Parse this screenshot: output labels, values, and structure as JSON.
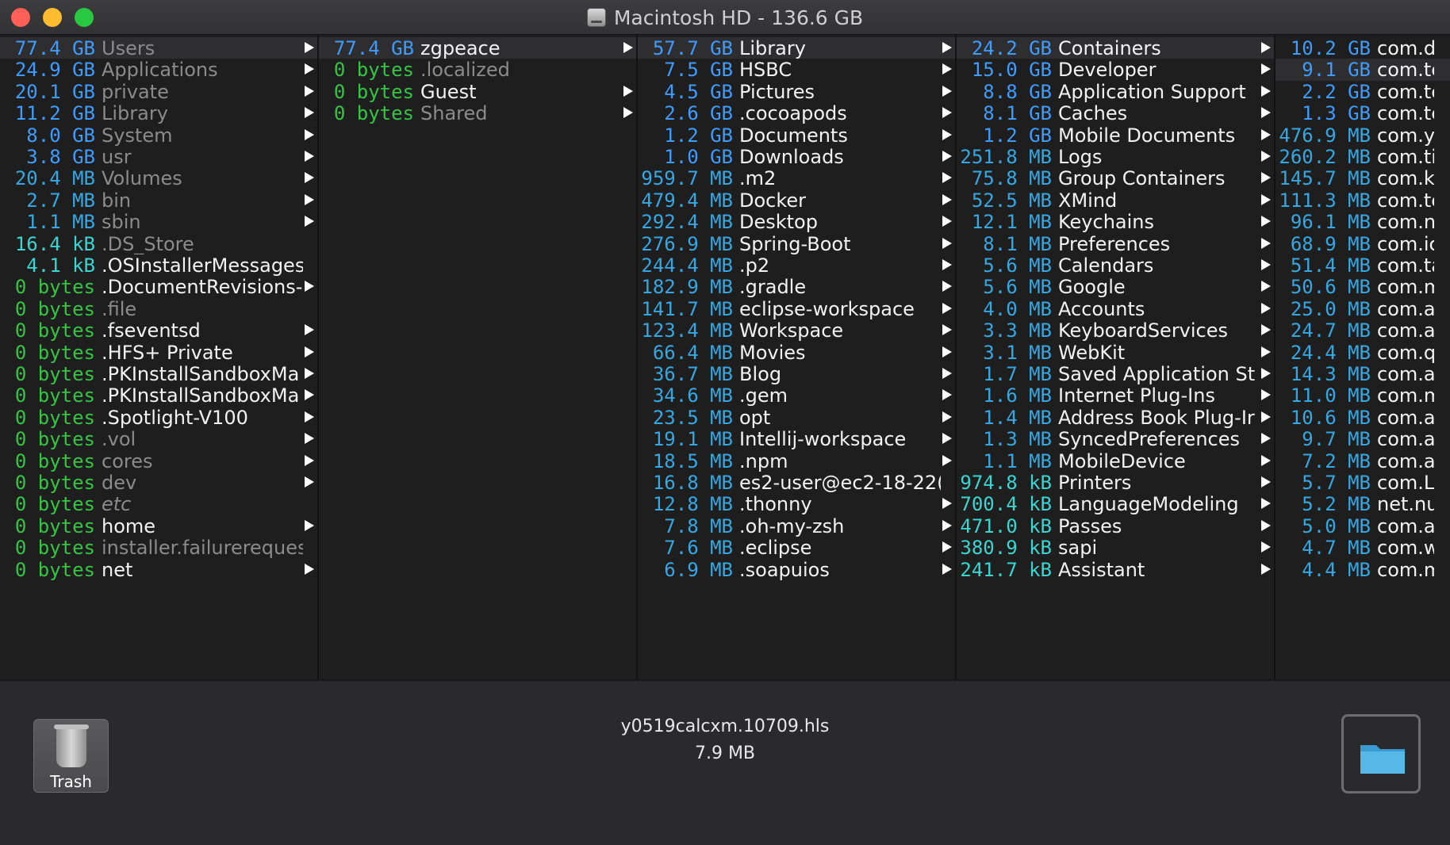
{
  "window": {
    "title": "Macintosh HD - 136.6 GB",
    "traffic_colors": {
      "close": "#fe5f57",
      "minimize": "#febc2e",
      "maximize": "#28c840"
    }
  },
  "colors": {
    "gb": "#3f9cff",
    "mb": "#35a8e4",
    "kb": "#39d6d2",
    "bytes": "#35c444",
    "name": "#f2f2f2",
    "name_dim": "#8b8b8b",
    "selected_row": "#2e2e31"
  },
  "columns": [
    {
      "id": "root",
      "items": [
        {
          "size": "77.4 GB",
          "unit": "gb",
          "name": "Users",
          "arrow": true,
          "dim": true,
          "selected": true
        },
        {
          "size": "24.9 GB",
          "unit": "gb",
          "name": "Applications",
          "arrow": true,
          "dim": true
        },
        {
          "size": "20.1 GB",
          "unit": "gb",
          "name": "private",
          "arrow": true,
          "dim": true
        },
        {
          "size": "11.2 GB",
          "unit": "gb",
          "name": "Library",
          "arrow": true,
          "dim": true
        },
        {
          "size": "8.0 GB",
          "unit": "gb",
          "name": "System",
          "arrow": true,
          "dim": true
        },
        {
          "size": "3.8 GB",
          "unit": "gb",
          "name": "usr",
          "arrow": true,
          "dim": true
        },
        {
          "size": "20.4 MB",
          "unit": "mb",
          "name": "Volumes",
          "arrow": true,
          "dim": true
        },
        {
          "size": "2.7 MB",
          "unit": "mb",
          "name": "bin",
          "arrow": true,
          "dim": true
        },
        {
          "size": "1.1 MB",
          "unit": "mb",
          "name": "sbin",
          "arrow": true,
          "dim": true
        },
        {
          "size": "16.4 kB",
          "unit": "kb",
          "name": ".DS_Store",
          "arrow": false,
          "dim": true
        },
        {
          "size": "4.1 kB",
          "unit": "kb",
          "name": ".OSInstallerMessages",
          "arrow": false
        },
        {
          "size": "0 bytes",
          "unit": "bytes",
          "name": ".DocumentRevisions-",
          "arrow": true
        },
        {
          "size": "0 bytes",
          "unit": "bytes",
          "name": ".file",
          "arrow": false,
          "dim": true
        },
        {
          "size": "0 bytes",
          "unit": "bytes",
          "name": ".fseventsd",
          "arrow": true
        },
        {
          "size": "0 bytes",
          "unit": "bytes",
          "name": ".HFS+ Private",
          "arrow": true
        },
        {
          "size": "0 bytes",
          "unit": "bytes",
          "name": ".PKInstallSandboxMa",
          "arrow": true
        },
        {
          "size": "0 bytes",
          "unit": "bytes",
          "name": ".PKInstallSandboxMa",
          "arrow": true
        },
        {
          "size": "0 bytes",
          "unit": "bytes",
          "name": ".Spotlight-V100",
          "arrow": true
        },
        {
          "size": "0 bytes",
          "unit": "bytes",
          "name": ".vol",
          "arrow": true,
          "dim": true
        },
        {
          "size": "0 bytes",
          "unit": "bytes",
          "name": "cores",
          "arrow": true,
          "dim": true
        },
        {
          "size": "0 bytes",
          "unit": "bytes",
          "name": "dev",
          "arrow": true,
          "dim": true
        },
        {
          "size": "0 bytes",
          "unit": "bytes",
          "name": "etc",
          "arrow": false,
          "dim": true,
          "italic": true
        },
        {
          "size": "0 bytes",
          "unit": "bytes",
          "name": "home",
          "arrow": true
        },
        {
          "size": "0 bytes",
          "unit": "bytes",
          "name": "installer.failurerequest",
          "arrow": false,
          "dim": true
        },
        {
          "size": "0 bytes",
          "unit": "bytes",
          "name": "net",
          "arrow": true
        }
      ]
    },
    {
      "id": "users",
      "items": [
        {
          "size": "77.4 GB",
          "unit": "gb",
          "name": "zgpeace",
          "arrow": true,
          "selected": true
        },
        {
          "size": "0 bytes",
          "unit": "bytes",
          "name": ".localized",
          "arrow": false,
          "dim": true
        },
        {
          "size": "0 bytes",
          "unit": "bytes",
          "name": "Guest",
          "arrow": true
        },
        {
          "size": "0 bytes",
          "unit": "bytes",
          "name": "Shared",
          "arrow": true,
          "dim": true
        }
      ]
    },
    {
      "id": "zgpeace",
      "items": [
        {
          "size": "57.7 GB",
          "unit": "gb",
          "name": "Library",
          "arrow": true,
          "selected": true
        },
        {
          "size": "7.5 GB",
          "unit": "gb",
          "name": "HSBC",
          "arrow": true
        },
        {
          "size": "4.5 GB",
          "unit": "gb",
          "name": "Pictures",
          "arrow": true
        },
        {
          "size": "2.6 GB",
          "unit": "gb",
          "name": ".cocoapods",
          "arrow": true
        },
        {
          "size": "1.2 GB",
          "unit": "gb",
          "name": "Documents",
          "arrow": true
        },
        {
          "size": "1.0 GB",
          "unit": "gb",
          "name": "Downloads",
          "arrow": true
        },
        {
          "size": "959.7 MB",
          "unit": "mb",
          "name": ".m2",
          "arrow": true
        },
        {
          "size": "479.4 MB",
          "unit": "mb",
          "name": "Docker",
          "arrow": true
        },
        {
          "size": "292.4 MB",
          "unit": "mb",
          "name": "Desktop",
          "arrow": true
        },
        {
          "size": "276.9 MB",
          "unit": "mb",
          "name": "Spring-Boot",
          "arrow": true
        },
        {
          "size": "244.4 MB",
          "unit": "mb",
          "name": ".p2",
          "arrow": true
        },
        {
          "size": "182.9 MB",
          "unit": "mb",
          "name": ".gradle",
          "arrow": true
        },
        {
          "size": "141.7 MB",
          "unit": "mb",
          "name": "eclipse-workspace",
          "arrow": true
        },
        {
          "size": "123.4 MB",
          "unit": "mb",
          "name": "Workspace",
          "arrow": true
        },
        {
          "size": "66.4 MB",
          "unit": "mb",
          "name": "Movies",
          "arrow": true
        },
        {
          "size": "36.7 MB",
          "unit": "mb",
          "name": "Blog",
          "arrow": true
        },
        {
          "size": "34.6 MB",
          "unit": "mb",
          "name": ".gem",
          "arrow": true
        },
        {
          "size": "23.5 MB",
          "unit": "mb",
          "name": "opt",
          "arrow": true
        },
        {
          "size": "19.1 MB",
          "unit": "mb",
          "name": "Intellij-workspace",
          "arrow": true
        },
        {
          "size": "18.5 MB",
          "unit": "mb",
          "name": ".npm",
          "arrow": true
        },
        {
          "size": "16.8 MB",
          "unit": "mb",
          "name": "es2-user@ec2-18-22(",
          "arrow": false
        },
        {
          "size": "12.8 MB",
          "unit": "mb",
          "name": ".thonny",
          "arrow": true
        },
        {
          "size": "7.8 MB",
          "unit": "mb",
          "name": ".oh-my-zsh",
          "arrow": true
        },
        {
          "size": "7.6 MB",
          "unit": "mb",
          "name": ".eclipse",
          "arrow": true
        },
        {
          "size": "6.9 MB",
          "unit": "mb",
          "name": ".soapuios",
          "arrow": true
        }
      ]
    },
    {
      "id": "library",
      "items": [
        {
          "size": "24.2 GB",
          "unit": "gb",
          "name": "Containers",
          "arrow": true,
          "selected": true
        },
        {
          "size": "15.0 GB",
          "unit": "gb",
          "name": "Developer",
          "arrow": true
        },
        {
          "size": "8.8 GB",
          "unit": "gb",
          "name": "Application Support",
          "arrow": true
        },
        {
          "size": "8.1 GB",
          "unit": "gb",
          "name": "Caches",
          "arrow": true
        },
        {
          "size": "1.2 GB",
          "unit": "gb",
          "name": "Mobile Documents",
          "arrow": true
        },
        {
          "size": "251.8 MB",
          "unit": "mb",
          "name": "Logs",
          "arrow": true
        },
        {
          "size": "75.8 MB",
          "unit": "mb",
          "name": "Group Containers",
          "arrow": true
        },
        {
          "size": "52.5 MB",
          "unit": "mb",
          "name": "XMind",
          "arrow": true
        },
        {
          "size": "12.1 MB",
          "unit": "mb",
          "name": "Keychains",
          "arrow": true
        },
        {
          "size": "8.1 MB",
          "unit": "mb",
          "name": "Preferences",
          "arrow": true
        },
        {
          "size": "5.6 MB",
          "unit": "mb",
          "name": "Calendars",
          "arrow": true
        },
        {
          "size": "5.6 MB",
          "unit": "mb",
          "name": "Google",
          "arrow": true
        },
        {
          "size": "4.0 MB",
          "unit": "mb",
          "name": "Accounts",
          "arrow": true
        },
        {
          "size": "3.3 MB",
          "unit": "mb",
          "name": "KeyboardServices",
          "arrow": true
        },
        {
          "size": "3.1 MB",
          "unit": "mb",
          "name": "WebKit",
          "arrow": true
        },
        {
          "size": "1.7 MB",
          "unit": "mb",
          "name": "Saved Application St",
          "arrow": true
        },
        {
          "size": "1.6 MB",
          "unit": "mb",
          "name": "Internet Plug-Ins",
          "arrow": true
        },
        {
          "size": "1.4 MB",
          "unit": "mb",
          "name": "Address Book Plug-Ir",
          "arrow": true
        },
        {
          "size": "1.3 MB",
          "unit": "mb",
          "name": "SyncedPreferences",
          "arrow": true
        },
        {
          "size": "1.1 MB",
          "unit": "mb",
          "name": "MobileDevice",
          "arrow": true
        },
        {
          "size": "974.8 kB",
          "unit": "kb",
          "name": "Printers",
          "arrow": true
        },
        {
          "size": "700.4 kB",
          "unit": "kb",
          "name": "LanguageModeling",
          "arrow": true
        },
        {
          "size": "471.0 kB",
          "unit": "kb",
          "name": "Passes",
          "arrow": true
        },
        {
          "size": "380.9 kB",
          "unit": "kb",
          "name": "sapi",
          "arrow": true
        },
        {
          "size": "241.7 kB",
          "unit": "kb",
          "name": "Assistant",
          "arrow": true
        }
      ]
    },
    {
      "id": "containers",
      "items": [
        {
          "size": "10.2 GB",
          "unit": "gb",
          "name": "com.d"
        },
        {
          "size": "9.1 GB",
          "unit": "gb",
          "name": "com.te",
          "selected": true
        },
        {
          "size": "2.2 GB",
          "unit": "gb",
          "name": "com.te"
        },
        {
          "size": "1.3 GB",
          "unit": "gb",
          "name": "com.te"
        },
        {
          "size": "476.9 MB",
          "unit": "mb",
          "name": "com.y"
        },
        {
          "size": "260.2 MB",
          "unit": "mb",
          "name": "com.ti"
        },
        {
          "size": "145.7 MB",
          "unit": "mb",
          "name": "com.k"
        },
        {
          "size": "111.3 MB",
          "unit": "mb",
          "name": "com.te"
        },
        {
          "size": "96.1 MB",
          "unit": "mb",
          "name": "com.n"
        },
        {
          "size": "68.9 MB",
          "unit": "mb",
          "name": "com.ic"
        },
        {
          "size": "51.4 MB",
          "unit": "mb",
          "name": "com.ta"
        },
        {
          "size": "50.6 MB",
          "unit": "mb",
          "name": "com.m"
        },
        {
          "size": "25.0 MB",
          "unit": "mb",
          "name": "com.a"
        },
        {
          "size": "24.7 MB",
          "unit": "mb",
          "name": "com.a"
        },
        {
          "size": "24.4 MB",
          "unit": "mb",
          "name": "com.q"
        },
        {
          "size": "14.3 MB",
          "unit": "mb",
          "name": "com.a"
        },
        {
          "size": "11.0 MB",
          "unit": "mb",
          "name": "com.m"
        },
        {
          "size": "10.6 MB",
          "unit": "mb",
          "name": "com.a"
        },
        {
          "size": "9.7 MB",
          "unit": "mb",
          "name": "com.a"
        },
        {
          "size": "7.2 MB",
          "unit": "mb",
          "name": "com.a"
        },
        {
          "size": "5.7 MB",
          "unit": "mb",
          "name": "com.L"
        },
        {
          "size": "5.2 MB",
          "unit": "mb",
          "name": "net.nu"
        },
        {
          "size": "5.0 MB",
          "unit": "mb",
          "name": "com.a"
        },
        {
          "size": "4.7 MB",
          "unit": "mb",
          "name": "com.w"
        },
        {
          "size": "4.4 MB",
          "unit": "mb",
          "name": "com.m"
        }
      ]
    }
  ],
  "footer": {
    "trash_label": "Trash",
    "trash_icon": "trash-icon",
    "selected_name": "y0519calcxm.10709.hls",
    "selected_size": "7.9 MB",
    "folder_icon": "folder-icon"
  }
}
